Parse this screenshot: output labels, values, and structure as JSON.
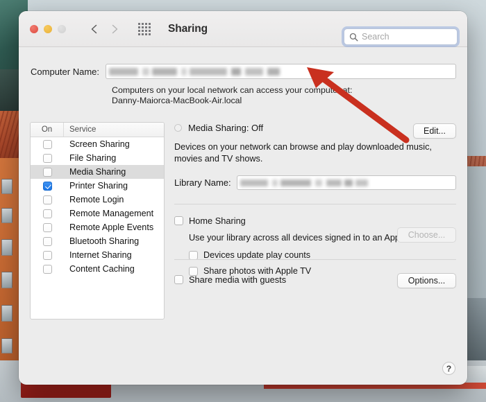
{
  "window": {
    "title": "Sharing",
    "traffic_lights": [
      "close",
      "minimize",
      "zoom"
    ],
    "back_icon": "chevron-left-icon",
    "forward_icon": "chevron-right-icon",
    "grid_icon": "show-all-grid-icon"
  },
  "search": {
    "placeholder": "Search",
    "value": "",
    "icon": "search-icon"
  },
  "computer_name": {
    "label": "Computer Name:",
    "value": "",
    "redacted": true,
    "hint_line1": "Computers on your local network can access your computer at:",
    "hint_line2": "Danny-Maiorca-MacBook-Air.local",
    "edit_button": "Edit..."
  },
  "services_table": {
    "columns": [
      "On",
      "Service"
    ],
    "rows": [
      {
        "name": "Screen Sharing",
        "on": false,
        "selected": false
      },
      {
        "name": "File Sharing",
        "on": false,
        "selected": false
      },
      {
        "name": "Media Sharing",
        "on": false,
        "selected": true
      },
      {
        "name": "Printer Sharing",
        "on": true,
        "selected": false
      },
      {
        "name": "Remote Login",
        "on": false,
        "selected": false
      },
      {
        "name": "Remote Management",
        "on": false,
        "selected": false
      },
      {
        "name": "Remote Apple Events",
        "on": false,
        "selected": false
      },
      {
        "name": "Bluetooth Sharing",
        "on": false,
        "selected": false
      },
      {
        "name": "Internet Sharing",
        "on": false,
        "selected": false
      },
      {
        "name": "Content Caching",
        "on": false,
        "selected": false
      }
    ]
  },
  "detail": {
    "status_label": "Media Sharing: Off",
    "status_indicator": "status-off-dot",
    "description": "Devices on your network can browse and play downloaded music, movies and TV shows.",
    "library_label": "Library Name:",
    "library_value": "",
    "library_redacted": true,
    "home_sharing": {
      "label": "Home Sharing",
      "checked": false,
      "description": "Use your library across all devices signed in to an Apple ID.",
      "devices_update_label": "Devices update play counts",
      "devices_update_checked": false,
      "share_photos_label": "Share photos with Apple TV",
      "share_photos_checked": false,
      "choose_button": "Choose...",
      "choose_button_disabled": true
    },
    "guests": {
      "label": "Share media with guests",
      "checked": false,
      "options_button": "Options..."
    }
  },
  "help_button": {
    "label": "?",
    "icon": "help-question-icon"
  },
  "annotation": {
    "type": "arrow",
    "color": "#c9301f",
    "points_to": "computer-name-field"
  },
  "colors": {
    "accent_blue": "#1a76e8",
    "focus_ring": "#7898d6",
    "window_bg": "#ececec",
    "selection_gray": "#dcdcdc",
    "annotation_red": "#c9301f"
  }
}
